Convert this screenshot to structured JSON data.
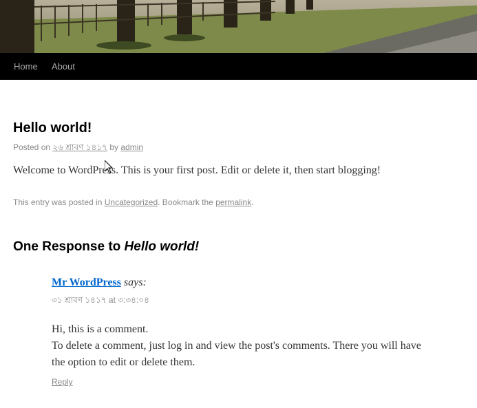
{
  "nav": {
    "items": [
      {
        "label": "Home"
      },
      {
        "label": "About"
      }
    ]
  },
  "post": {
    "title": "Hello world!",
    "meta_prefix": "Posted on",
    "date": "২৬ শ্রাবণ ১৪১৭",
    "meta_by": "by",
    "author": "admin",
    "content": "Welcome to WordPress. This is your first post. Edit or delete it, then start blogging!",
    "footer_prefix": "This entry was posted in",
    "category": "Uncategorized",
    "footer_middle": ". Bookmark the",
    "permalink": "permalink",
    "footer_suffix": "."
  },
  "comments": {
    "title_prefix": "One Response to",
    "title_post": "Hello world!",
    "items": [
      {
        "author": "Mr WordPress",
        "says": "says:",
        "datetime": "৩১ শ্রাবণ ১৪১৭ at ৩:৩৪:০৪",
        "text_line1": "Hi, this is a comment.",
        "text_line2": "To delete a comment, just log in and view the post's comments. There you will have the option to edit or delete them.",
        "reply_label": "Reply"
      }
    ]
  },
  "colors": {
    "nav_bg": "#000000",
    "link": "#0066cc",
    "meta_text": "#888888"
  }
}
